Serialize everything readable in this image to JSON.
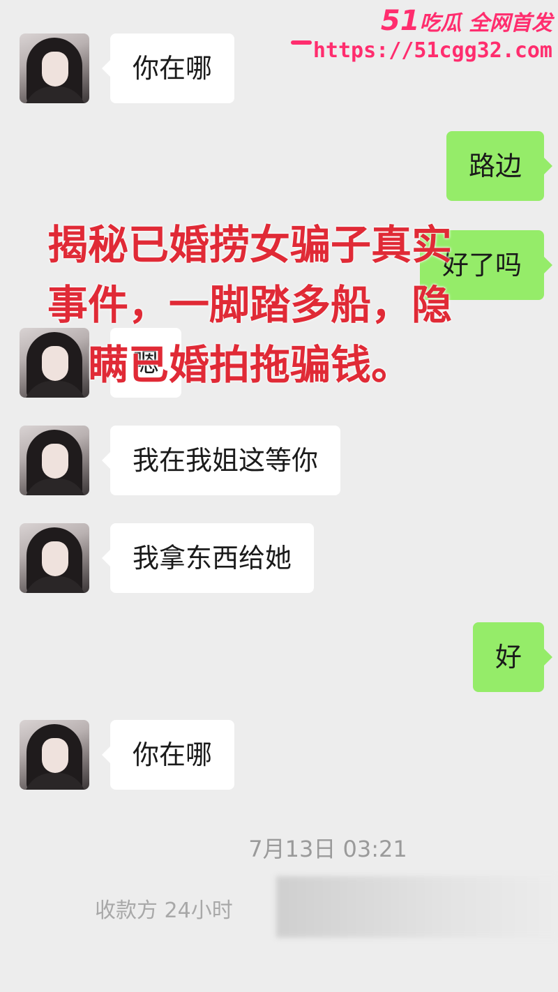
{
  "watermark": {
    "number": "51",
    "site_name": "吃瓜 全网首发",
    "url": "https://51cgg32.com"
  },
  "messages": [
    {
      "side": "in",
      "text": "你在哪"
    },
    {
      "side": "out",
      "text": "路边"
    },
    {
      "side": "out",
      "text": "好了吗"
    },
    {
      "side": "in",
      "text": "嗯"
    },
    {
      "side": "in",
      "text": "我在我姐这等你"
    },
    {
      "side": "in",
      "text": "我拿东西给她"
    },
    {
      "side": "out",
      "text": "好"
    },
    {
      "side": "in",
      "text": "你在哪"
    }
  ],
  "timestamp": "7月13日 03:21",
  "notice": "收款方 24小时",
  "overlay_caption": "揭秘已婚捞女骗子真实事件，一脚踏多船，隐瞒已婚拍拖骗钱。",
  "colors": {
    "background": "#ededed",
    "incoming_bubble": "#ffffff",
    "outgoing_bubble": "#95ec69",
    "caption": "#e02a36",
    "watermark": "#ff2d6e"
  }
}
